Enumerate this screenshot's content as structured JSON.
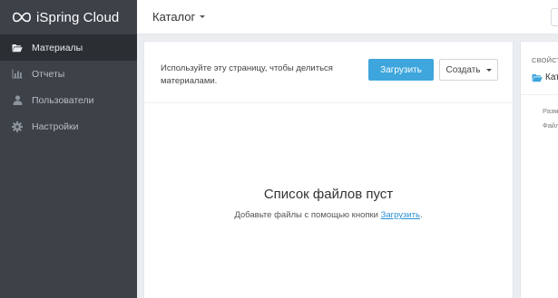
{
  "app": {
    "brand": "iSpring Cloud",
    "logo_icon": "ispring-logo-icon"
  },
  "colors": {
    "accent": "#3ea6dc",
    "sidebar_bg": "#3d4148",
    "sidebar_active": "#2b2f34",
    "link": "#2a8fd6"
  },
  "sidebar": {
    "items": [
      {
        "label": "Материалы",
        "icon": "folder-open-icon",
        "active": true
      },
      {
        "label": "Отчеты",
        "icon": "bar-chart-icon",
        "active": false
      },
      {
        "label": "Пользователи",
        "icon": "user-icon",
        "active": false
      },
      {
        "label": "Настройки",
        "icon": "gear-icon",
        "active": false
      }
    ]
  },
  "header": {
    "title": "Каталог"
  },
  "main": {
    "hint": "Используйте эту страницу, чтобы делиться материалами.",
    "upload_label": "Загрузить",
    "create_label": "Создать",
    "empty_title": "Список файлов пуст",
    "empty_text_before": "Добавьте файлы с помощью кнопки ",
    "empty_link": "Загрузить",
    "empty_text_after": "."
  },
  "properties": {
    "title": "СВОЙСТВА",
    "folder_name": "Каталог",
    "rows": [
      "Размер",
      "Файлы"
    ]
  }
}
